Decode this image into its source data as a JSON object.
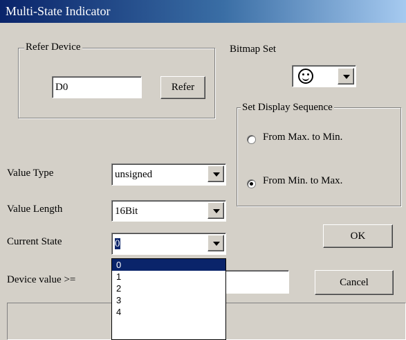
{
  "window": {
    "title": "Multi-State Indicator"
  },
  "refer_device": {
    "group_label": "Refer Device",
    "device_value": "D0",
    "refer_button": "Refer"
  },
  "bitmap_set": {
    "label": "Bitmap Set",
    "selected_icon": "smiley-face-icon"
  },
  "display_sequence": {
    "group_label": "Set Display Sequence",
    "options": [
      {
        "label": "From Max. to Min.",
        "checked": false
      },
      {
        "label": "From Min. to Max.",
        "checked": true
      }
    ]
  },
  "value_type": {
    "label": "Value Type",
    "value": "unsigned"
  },
  "value_length": {
    "label": "Value Length",
    "value": "16Bit"
  },
  "current_state": {
    "label": "Current State",
    "value": "0",
    "options": [
      "0",
      "1",
      "2",
      "3",
      "4"
    ],
    "selected_index": 0
  },
  "device_value_row": {
    "label": "Device value >=",
    "value": ""
  },
  "buttons": {
    "ok": "OK",
    "cancel": "Cancel"
  },
  "colors": {
    "title_start": "#0a246a",
    "title_end": "#a6caf0",
    "face": "#d4d0c8",
    "selection": "#0a246a"
  }
}
